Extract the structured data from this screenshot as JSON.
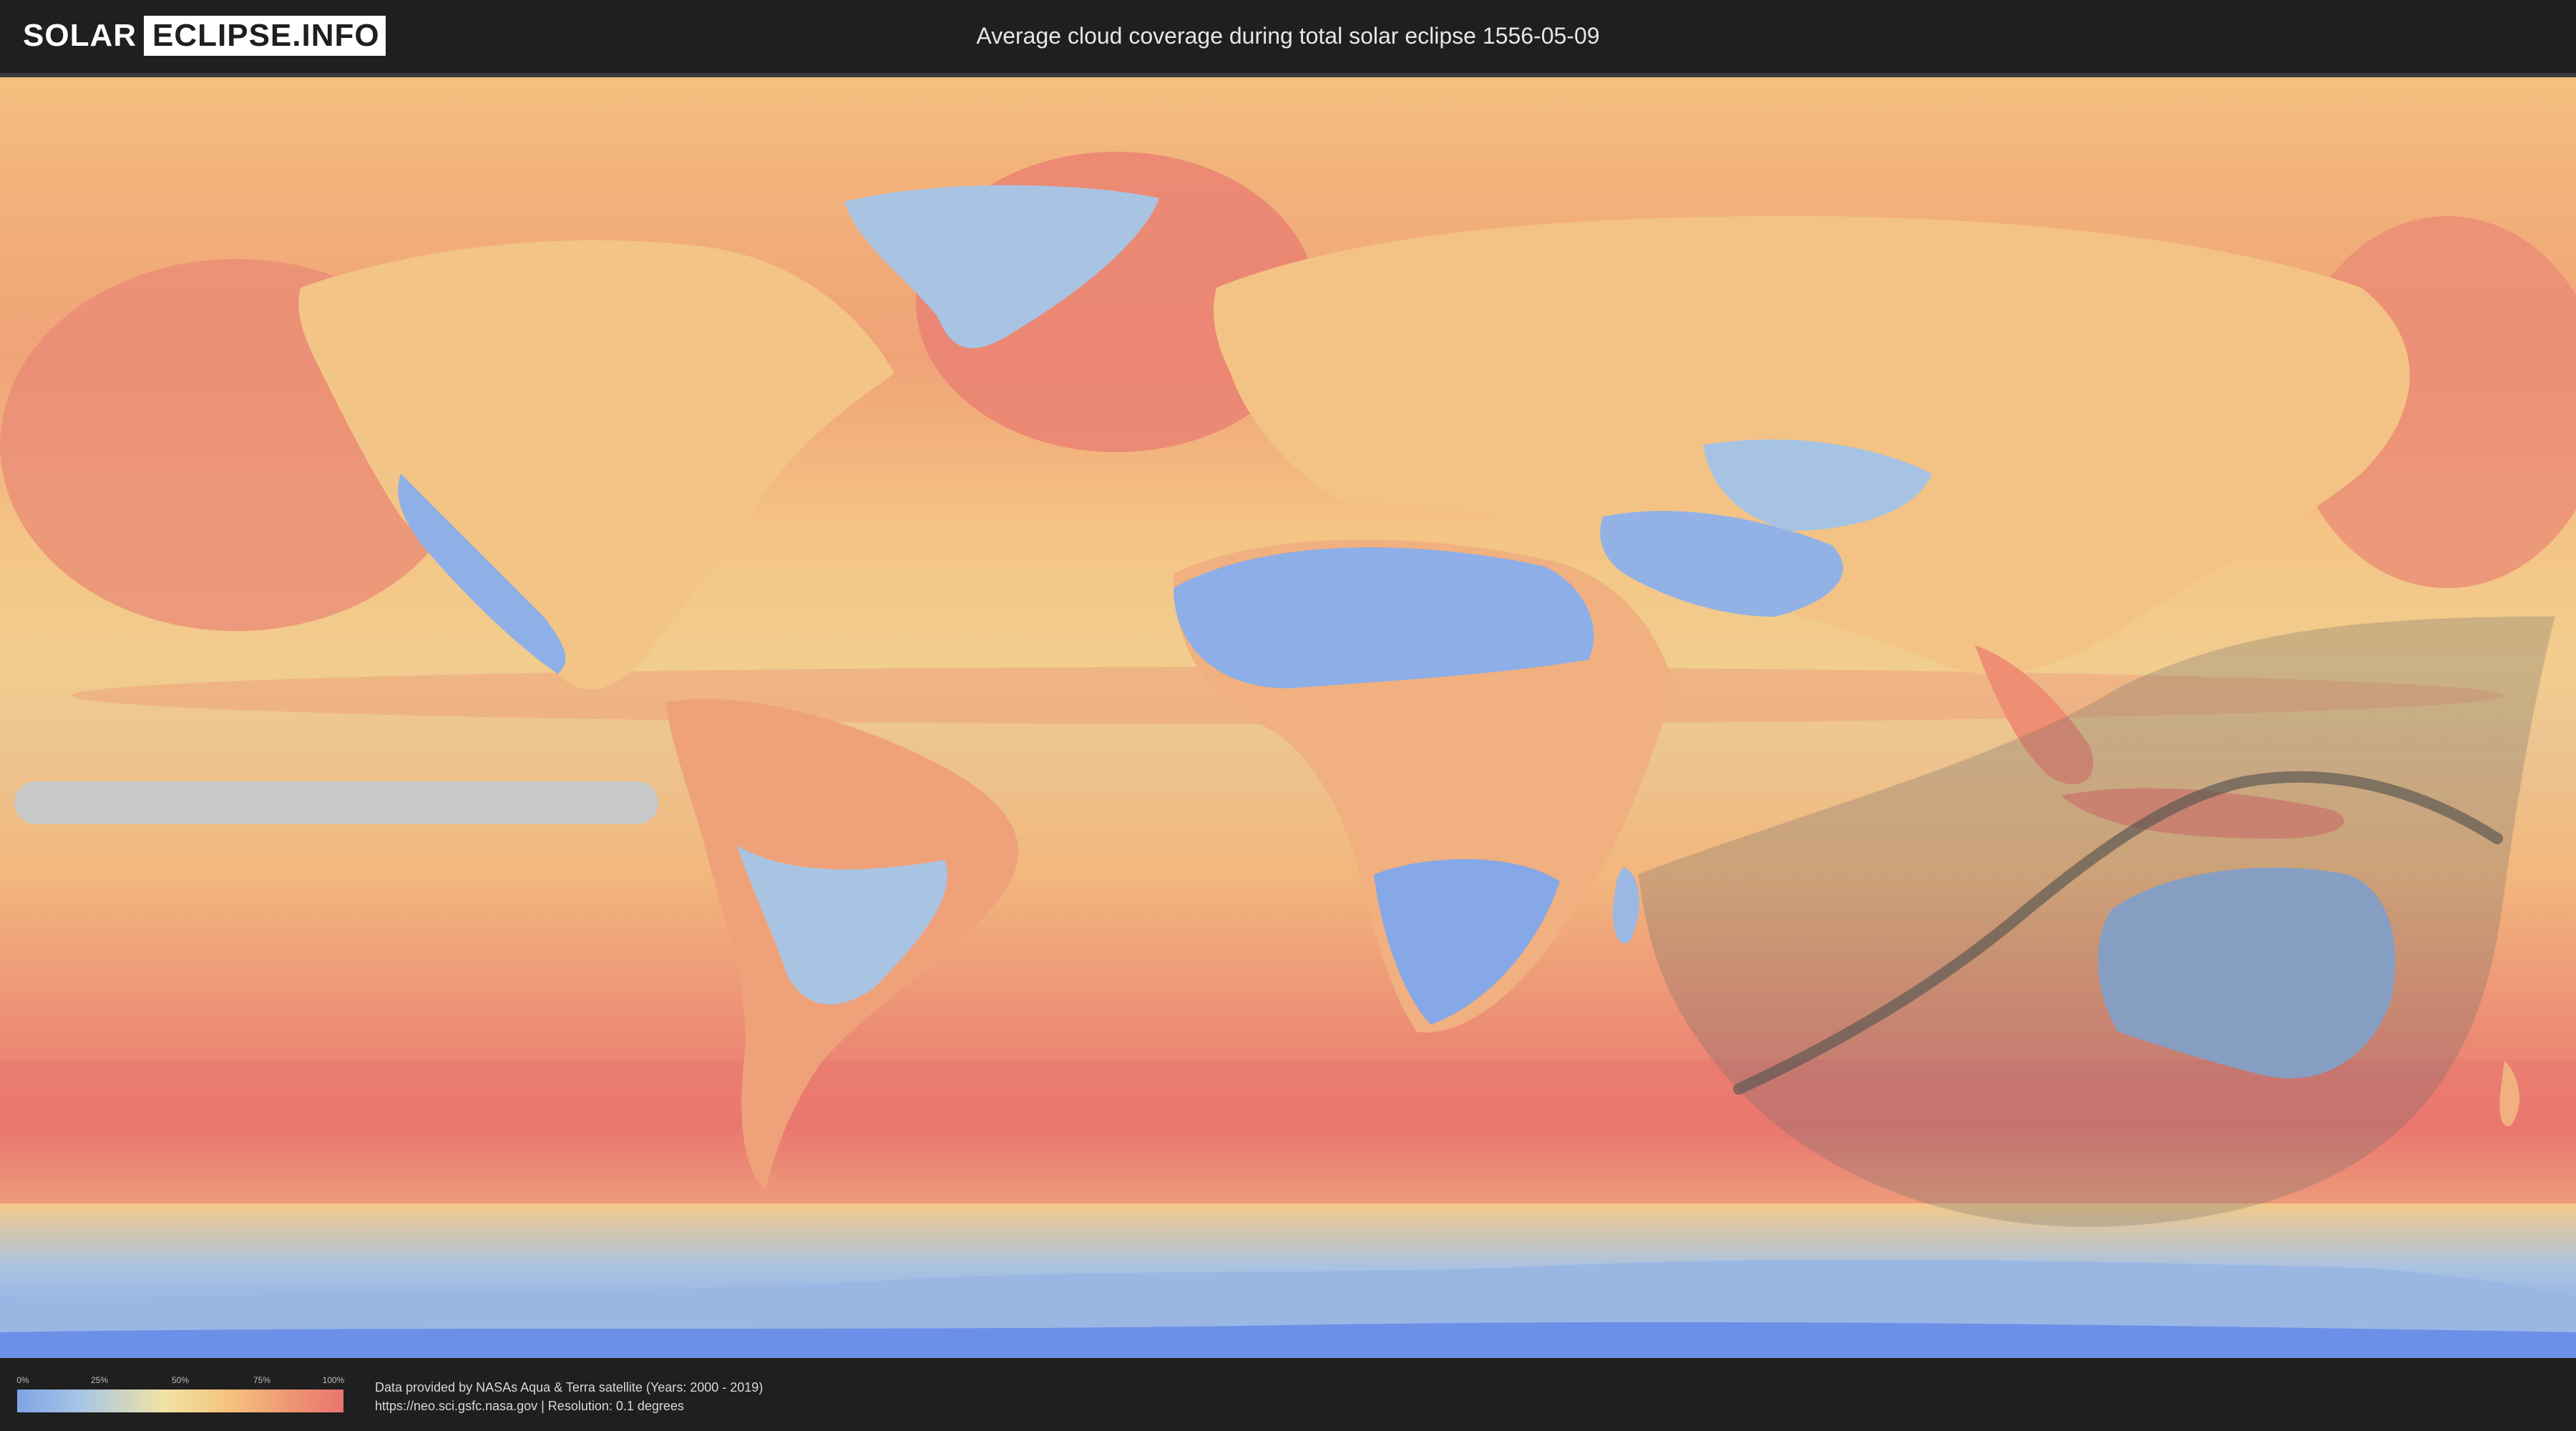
{
  "header": {
    "logo": {
      "part1": "SOLAR",
      "part2": "ECLIPSE.INFO"
    },
    "title": "Average cloud coverage during total solar eclipse 1556-05-09"
  },
  "map": {
    "colors": {
      "clear": "#7ea4e6",
      "low": "#a9c6e4",
      "medium": "#f1e3a6",
      "high": "#f4c27c",
      "overcast": "#e97470",
      "eclipse_shadow": "#6b6b6b"
    }
  },
  "legend": {
    "ticks": [
      "0%",
      "25%",
      "50%",
      "75%",
      "100%"
    ]
  },
  "footer": {
    "line1": "Data provided by NASAs Aqua & Terra satellite (Years: 2000 - 2019)",
    "line2": "https://neo.sci.gsfc.nasa.gov | Resolution: 0.1 degrees"
  }
}
